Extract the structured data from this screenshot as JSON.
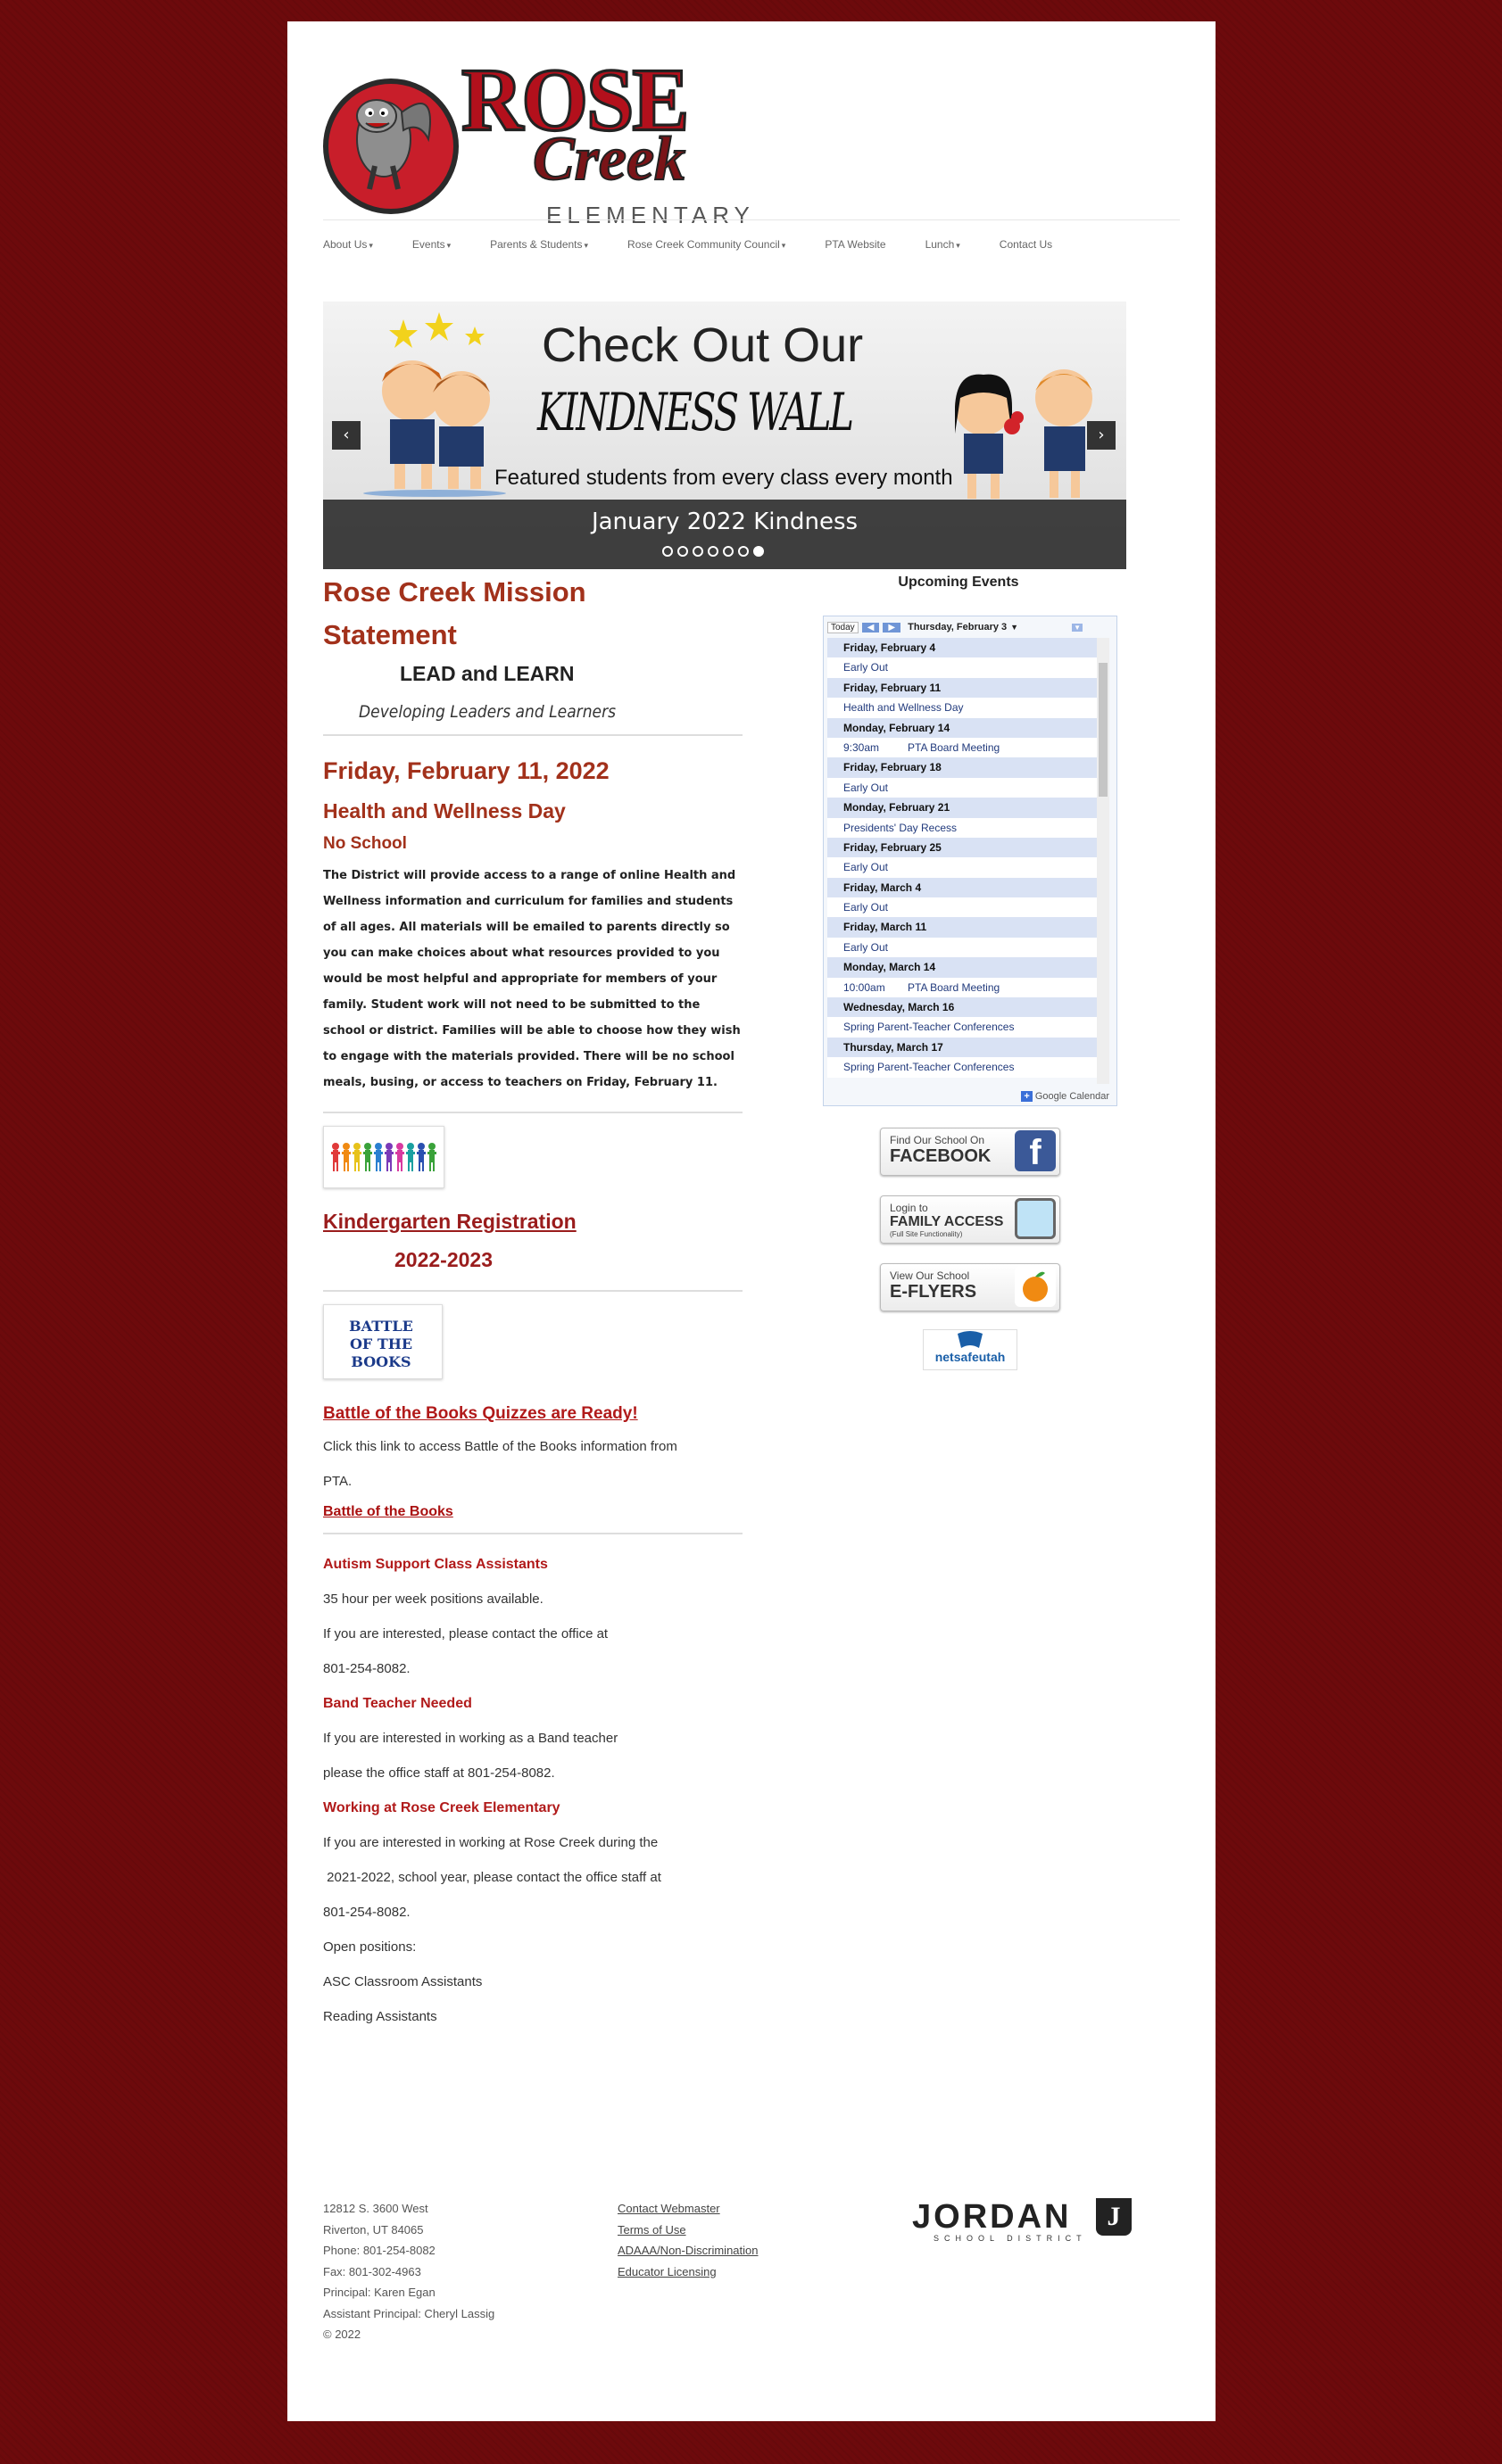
{
  "logo": {
    "rose": "ROSE",
    "creek": "Creek",
    "elementary": "ELEMENTARY"
  },
  "nav": [
    "About Us",
    "Events",
    "Parents & Students",
    "Rose Creek Community Council",
    "PTA Website",
    "Lunch",
    "Contact Us"
  ],
  "nav_dropdown": [
    true,
    true,
    true,
    true,
    false,
    true,
    false
  ],
  "slider": {
    "line1": "Check Out Our",
    "line2": "KINDNESS WALL",
    "line3": "Featured students from every class every month",
    "caption": "January 2022 Kindness",
    "slide_count": 7,
    "active_slide": 7
  },
  "mission": {
    "title": "Rose Creek Mission Statement",
    "lead": "LEAD and LEARN",
    "tagline": "Developing Leaders and Learners"
  },
  "announcement": {
    "date": "Friday, February 11, 2022",
    "title": "Health and Wellness Day",
    "subtitle": "No School",
    "body": "The District will provide access to a range of online Health and Wellness information and curriculum for families and students of all ages. All materials will be emailed to parents directly so you can make choices about what resources provided to you would be most helpful and appropriate for members of your family. Student work will not need to be submitted to the school or district. Families will be able to choose how they wish to engage with the materials provided. There will be no school meals, busing, or access to teachers on Friday, February 11."
  },
  "kindergarten": {
    "title": "Kindergarten Registration",
    "year": "2022-2023"
  },
  "battle": {
    "thumb_text": "BATTLE OF THE BOOKS",
    "title": "Battle of the Books Quizzes are Ready!",
    "text1": "Click this link to access Battle of the Books information from",
    "text2": "PTA.",
    "link": "Battle of the Books"
  },
  "jobs": {
    "autism_title": "Autism Support Class Assistants",
    "autism_1": "35 hour per week positions available.",
    "autism_2": "If you are interested, please contact the office at",
    "autism_3": "801-254-8082.",
    "band_title": "Band Teacher Needed",
    "band_1": "If you are interested in working as a Band teacher",
    "band_2": "please the office staff at 801-254-8082.",
    "work_title": "Working at Rose Creek Elementary",
    "work_1": "If you are interested in working at Rose Creek during the",
    "work_2": " 2021-2022, school year, please contact the office staff at",
    "work_3": "801-254-8082.",
    "work_4": "Open positions:",
    "work_5": "ASC Classroom Assistants",
    "work_6": "Reading Assistants"
  },
  "events": {
    "title": "Upcoming Events",
    "today": "Today",
    "current_date": "Thursday, February 3",
    "google_calendar": "Google Calendar",
    "rows": [
      {
        "type": "day",
        "text": "Friday, February 4"
      },
      {
        "type": "event",
        "time": "",
        "text": "Early Out"
      },
      {
        "type": "day",
        "text": "Friday, February 11"
      },
      {
        "type": "event",
        "time": "",
        "text": "Health and Wellness Day"
      },
      {
        "type": "day",
        "text": "Monday, February 14"
      },
      {
        "type": "event",
        "time": "9:30am",
        "text": "PTA Board Meeting"
      },
      {
        "type": "day",
        "text": "Friday, February 18"
      },
      {
        "type": "event",
        "time": "",
        "text": "Early Out"
      },
      {
        "type": "day",
        "text": "Monday, February 21"
      },
      {
        "type": "event",
        "time": "",
        "text": "Presidents' Day Recess"
      },
      {
        "type": "day",
        "text": "Friday, February 25"
      },
      {
        "type": "event",
        "time": "",
        "text": "Early Out"
      },
      {
        "type": "day",
        "text": "Friday, March 4"
      },
      {
        "type": "event",
        "time": "",
        "text": "Early Out"
      },
      {
        "type": "day",
        "text": "Friday, March 11"
      },
      {
        "type": "event",
        "time": "",
        "text": "Early Out"
      },
      {
        "type": "day",
        "text": "Monday, March 14"
      },
      {
        "type": "event",
        "time": "10:00am",
        "text": "PTA Board Meeting"
      },
      {
        "type": "day",
        "text": "Wednesday, March 16"
      },
      {
        "type": "event",
        "time": "",
        "text": "Spring Parent-Teacher Conferences"
      },
      {
        "type": "day",
        "text": "Thursday, March 17"
      },
      {
        "type": "event",
        "time": "",
        "text": "Spring Parent-Teacher Conferences"
      }
    ]
  },
  "sidebar_buttons": {
    "facebook_small": "Find Our School On",
    "facebook_big": "FACEBOOK",
    "family_small": "Login to",
    "family_big": "FAMILY ACCESS",
    "family_note": "(Full Site Functionality)",
    "eflyers_small": "View Our School",
    "eflyers_big": "E-FLYERS",
    "netsafe": "netsafeutah"
  },
  "footer": {
    "address": [
      "12812 S. 3600 West",
      "Riverton, UT 84065",
      "Phone: 801-254-8082",
      "Fax: 801-302-4963",
      "Principal: Karen Egan",
      "Assistant Principal: Cheryl Lassig",
      "© 2022"
    ],
    "links": [
      "Contact Webmaster",
      "Terms of Use",
      "ADAAA/Non-Discrimination",
      "Educator Licensing"
    ],
    "district_name": "JORDAN",
    "district_sub": "SCHOOL DISTRICT",
    "district_letter": "J"
  },
  "colors": {
    "background": "#6d0a0c",
    "heading": "#a2311b",
    "link": "#9a1c1c",
    "calendar_day": "#d9e2f4"
  }
}
